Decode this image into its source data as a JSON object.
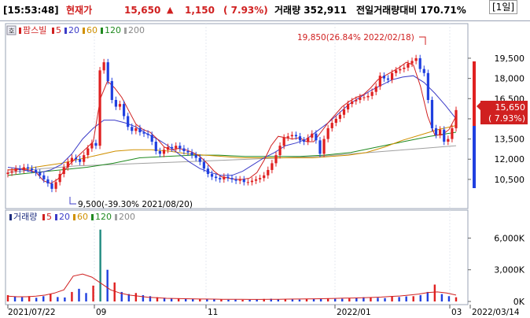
{
  "info": {
    "time": "[15:53:48]",
    "current_label": "현재가",
    "price": "15,650",
    "arrow": "▲",
    "change": "1,150",
    "percent": "( 7.93%)",
    "volume": "거래량 352,911",
    "ratio": "전일거래량대비 170.71%",
    "period": "[1일]"
  },
  "main_panel": {
    "toggle_icon": "호",
    "legend": [
      {
        "label": "팜스빌",
        "color": "#d02020"
      },
      {
        "label": "5",
        "color": "#d02020"
      },
      {
        "label": "20",
        "color": "#3c3cc8"
      },
      {
        "label": "60",
        "color": "#d09000"
      },
      {
        "label": "120",
        "color": "#208a20"
      },
      {
        "label": "200",
        "color": "#a0a0a0"
      }
    ],
    "high_annotation": "19,850(26.84% 2022/02/18)",
    "low_annotation": "9,500(-39.30% 2021/08/20)",
    "price_tag": "15,650",
    "pct_tag": "( 7.93%)",
    "y_labels": [
      "19,500",
      "18,000",
      "16,500",
      "15,000",
      "13,500",
      "12,000",
      "10,500"
    ]
  },
  "volume_panel": {
    "legend": [
      {
        "label": "거래량",
        "color": "#203080"
      },
      {
        "label": "5",
        "color": "#d02020"
      },
      {
        "label": "20",
        "color": "#3c3cc8"
      },
      {
        "label": "60",
        "color": "#d09000"
      },
      {
        "label": "120",
        "color": "#208a20"
      },
      {
        "label": "200",
        "color": "#a0a0a0"
      }
    ],
    "y_labels": [
      "6,000K",
      "3,000K",
      "0K"
    ]
  },
  "x_labels": [
    "2021/07/22",
    "09",
    "11",
    "2022/01",
    "03",
    "2022/03/14"
  ],
  "chart_data": {
    "type": "candlestick",
    "title": "팜스빌",
    "xlim": [
      "2021/07/22",
      "2022/03/14"
    ],
    "price_ylim": [
      9500,
      20200
    ],
    "volume_ylim_k": [
      0,
      7300
    ],
    "close_series": [
      11000,
      11100,
      11300,
      11200,
      11400,
      11300,
      11200,
      11000,
      10800,
      10500,
      10200,
      9800,
      10300,
      10900,
      11400,
      11800,
      12100,
      12000,
      11800,
      12300,
      12800,
      13200,
      13000,
      18600,
      19200,
      17800,
      16400,
      15900,
      16100,
      15200,
      14400,
      14100,
      14300,
      14000,
      13900,
      13800,
      13300,
      12600,
      12400,
      12700,
      12900,
      12800,
      13000,
      12800,
      12600,
      12500,
      12300,
      12100,
      11800,
      11300,
      10900,
      10700,
      10600,
      10500,
      10700,
      10600,
      10500,
      10400,
      10500,
      10300,
      10300,
      10400,
      10500,
      10600,
      10800,
      11200,
      11700,
      12300,
      13000,
      13600,
      13700,
      13800,
      13700,
      13400,
      13300,
      13600,
      13900,
      13400,
      12400,
      13500,
      14300,
      14700,
      15000,
      15300,
      15700,
      16100,
      16300,
      16400,
      16600,
      16600,
      16700,
      17000,
      17400,
      18200,
      18000,
      17900,
      18400,
      18600,
      18700,
      18800,
      19100,
      19300,
      19500,
      18700,
      18400,
      16400,
      14300,
      13800,
      14200,
      13300,
      13500,
      14300,
      15650
    ],
    "ma5": {
      "values": [
        11200,
        11200,
        11300,
        11200,
        11000,
        10400,
        10200,
        10500,
        11200,
        11800,
        12300,
        12800,
        13300,
        16500,
        17800,
        17300,
        16600,
        15600,
        14600,
        14200,
        14000,
        13500,
        12900,
        12700,
        12800,
        12700,
        12500,
        12200,
        11700,
        11100,
        10700,
        10600,
        10500,
        10500,
        10600,
        11000,
        11900,
        13000,
        13700,
        13600,
        13500,
        13600,
        13300,
        13300,
        14000,
        14700,
        15300,
        15900,
        16300,
        16600,
        16800,
        17300,
        17900,
        18200,
        18500,
        18800,
        19200,
        19000,
        17400,
        15200,
        13800,
        13800,
        14200,
        15200
      ],
      "color": "#d02020"
    },
    "ma20": {
      "values": [
        11400,
        11300,
        11100,
        11000,
        11200,
        11600,
        12400,
        13500,
        14300,
        14900,
        14900,
        14700,
        14400,
        13900,
        13500,
        13000,
        12400,
        11800,
        11300,
        11000,
        10800,
        10800,
        11100,
        11600,
        12100,
        12500,
        13000,
        13200,
        13500,
        14100,
        14700,
        15400,
        16100,
        16600,
        17100,
        17500,
        17900,
        18100,
        18200,
        17700,
        16900,
        16000,
        15000
      ],
      "color": "#3c3cc8"
    },
    "ma60": {
      "values": [
        11200,
        11300,
        11500,
        11700,
        12000,
        12300,
        12600,
        12700,
        12700,
        12600,
        12400,
        12300,
        12200,
        12100,
        12100,
        12100,
        12100,
        12100,
        12200,
        12300,
        12500,
        12900,
        13400,
        13800,
        14200,
        14500
      ],
      "color": "#d09000"
    },
    "ma120": {
      "values": [
        10800,
        11000,
        11200,
        11400,
        11700,
        12100,
        12200,
        12300,
        12300,
        12200,
        12200,
        12200,
        12300,
        12500,
        12900,
        13300,
        13700,
        14000
      ],
      "color": "#208a20"
    },
    "ma200": {
      "values": [
        11000,
        11300,
        11500,
        11600,
        11700,
        11800,
        11900,
        12000,
        12100,
        12200,
        12400,
        12600,
        12800,
        13000
      ],
      "color": "#a0a0a0"
    },
    "volume_bars_k": [
      600,
      450,
      400,
      500,
      350,
      500,
      700,
      420,
      380,
      900,
      1200,
      800,
      1500,
      6800,
      3000,
      1800,
      900,
      700,
      800,
      600,
      500,
      400,
      350,
      300,
      300,
      250,
      230,
      220,
      200,
      210,
      180,
      160,
      170,
      150,
      160,
      180,
      240,
      260,
      220,
      200,
      190,
      180,
      230,
      240,
      280,
      300,
      250,
      260,
      290,
      350,
      400,
      380,
      350,
      320,
      450,
      420,
      480,
      500,
      600,
      900,
      1600,
      700,
      500,
      400
    ],
    "volume_ma5_k": [
      500,
      450,
      450,
      500,
      600,
      800,
      1100,
      2400,
      2600,
      2300,
      1700,
      1100,
      800,
      600,
      500,
      400,
      350,
      300,
      280,
      260,
      240,
      230,
      220,
      210,
      200,
      200,
      190,
      190,
      200,
      210,
      220,
      230,
      240,
      250,
      270,
      290,
      310,
      330,
      350,
      380,
      420,
      480,
      520,
      600,
      700,
      850,
      900,
      800,
      600
    ]
  }
}
